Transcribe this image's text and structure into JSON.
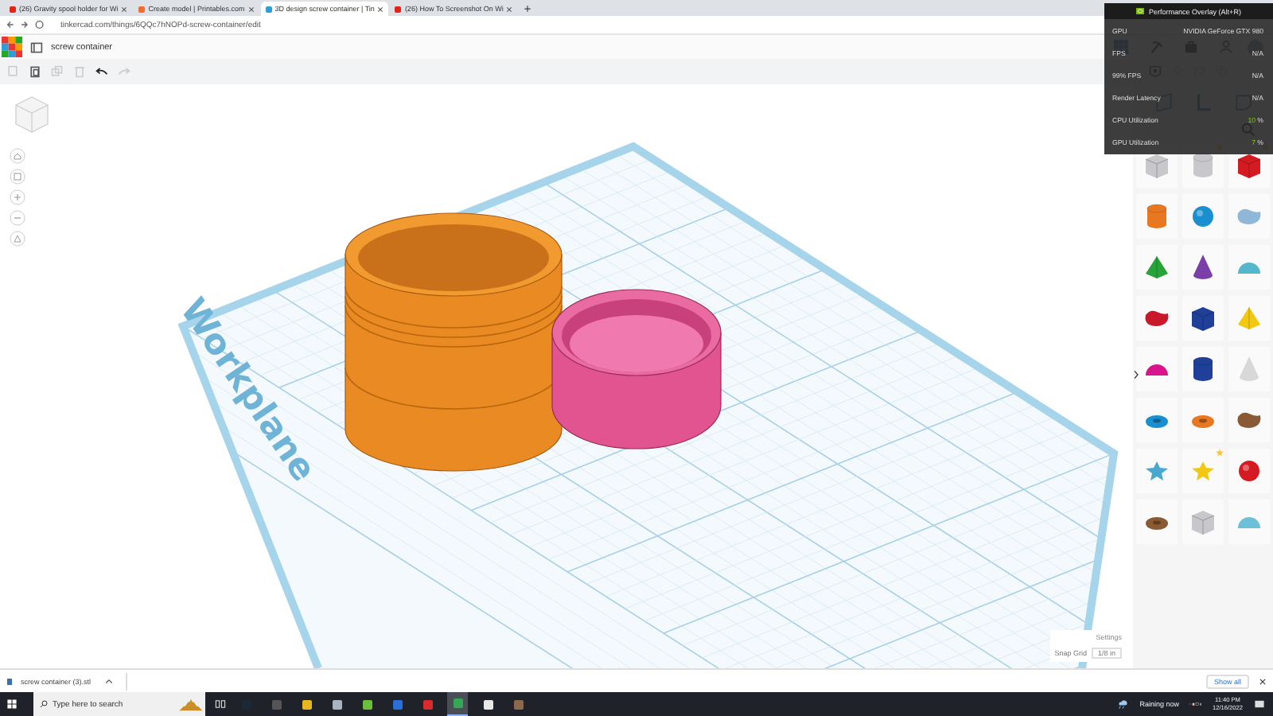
{
  "browser_tabs": [
    {
      "title": "(26) Gravity spool holder for Wi",
      "color": "#e62117",
      "selected": false
    },
    {
      "title": "Create model | Printables.com",
      "color": "#f26c2b",
      "selected": false
    },
    {
      "title": "3D design screw container | Tin",
      "color": "#2a9fd8",
      "selected": true
    },
    {
      "title": "(26) How To Screenshot On Wi",
      "color": "#e62117",
      "selected": false
    }
  ],
  "address": "tinkercad.com/things/6QQc7hNOPd-screw-container/edit",
  "design_title": "screw container",
  "performance_overlay": {
    "title": "Performance Overlay (Alt+R)",
    "rows": [
      {
        "label": "GPU",
        "value": "NVIDIA GeForce GTX 980",
        "kind": "text"
      },
      {
        "label": "FPS",
        "value": "N/A",
        "kind": "text"
      },
      {
        "label": "99% FPS",
        "value": "N/A",
        "kind": "text"
      },
      {
        "label": "Render Latency",
        "value": "N/A",
        "kind": "text"
      },
      {
        "label": "CPU Utilization",
        "value": "10",
        "kind": "meter"
      },
      {
        "label": "GPU Utilization",
        "value": "7",
        "kind": "meter"
      }
    ],
    "unit": "%"
  },
  "workplane_label": "Workplane",
  "shapes": [
    {
      "kind": "box",
      "color": "#c8c8cc",
      "starred": false
    },
    {
      "kind": "cylinder",
      "color": "#c8c8cc",
      "starred": true
    },
    {
      "kind": "box",
      "color": "#d41b22",
      "starred": true
    },
    {
      "kind": "cylinder",
      "color": "#e87722",
      "starred": false
    },
    {
      "kind": "sphere",
      "color": "#1a8fd0",
      "starred": false
    },
    {
      "kind": "blob",
      "color": "#8fb8d8",
      "starred": false
    },
    {
      "kind": "pyramid",
      "color": "#27a33a",
      "starred": false
    },
    {
      "kind": "cone",
      "color": "#7a3fa8",
      "starred": false
    },
    {
      "kind": "half-sphere",
      "color": "#56b6cc",
      "starred": false
    },
    {
      "kind": "blob",
      "color": "#c8182a",
      "starred": false
    },
    {
      "kind": "box",
      "color": "#1f3f99",
      "starred": false
    },
    {
      "kind": "pyramid",
      "color": "#f2c811",
      "starred": false
    },
    {
      "kind": "half-sphere",
      "color": "#d6168a",
      "starred": false
    },
    {
      "kind": "cylinder",
      "color": "#1f3f99",
      "starred": false
    },
    {
      "kind": "cone",
      "color": "#d8d8d8",
      "starred": false
    },
    {
      "kind": "torus",
      "color": "#1a8fd0",
      "starred": false
    },
    {
      "kind": "torus",
      "color": "#e87722",
      "starred": false
    },
    {
      "kind": "blob",
      "color": "#8a5a34",
      "starred": false
    },
    {
      "kind": "star",
      "color": "#4aa8d0",
      "starred": false
    },
    {
      "kind": "star",
      "color": "#f2c811",
      "starred": true
    },
    {
      "kind": "sphere",
      "color": "#d41b22",
      "starred": false
    },
    {
      "kind": "torus",
      "color": "#8a5a34",
      "starred": false
    },
    {
      "kind": "box",
      "color": "#c8c8cc",
      "starred": false
    },
    {
      "kind": "half-sphere",
      "color": "#6cc0d8",
      "starred": false
    }
  ],
  "settings_link": "Settings",
  "snap_grid": {
    "label": "Snap Grid",
    "value": "1/8 in"
  },
  "download": {
    "file": "screw container (3).stl",
    "show_all": "Show all"
  },
  "taskbar": {
    "search_placeholder": "Type here to search",
    "weather": "Raining now",
    "time": "11:40 PM",
    "date": "12/16/2022",
    "apps": [
      {
        "color": "#1b2838",
        "selected": false
      },
      {
        "color": "#555555",
        "selected": false
      },
      {
        "color": "#e8b720",
        "selected": false
      },
      {
        "color": "#aab4c0",
        "selected": false
      },
      {
        "color": "#6cbf3a",
        "selected": false
      },
      {
        "color": "#2a6fd8",
        "selected": false
      },
      {
        "color": "#d82c2c",
        "selected": false
      },
      {
        "color": "#34a853",
        "selected": true
      },
      {
        "color": "#e8e8e8",
        "selected": false
      },
      {
        "color": "#8a6a4a",
        "selected": false
      }
    ]
  }
}
